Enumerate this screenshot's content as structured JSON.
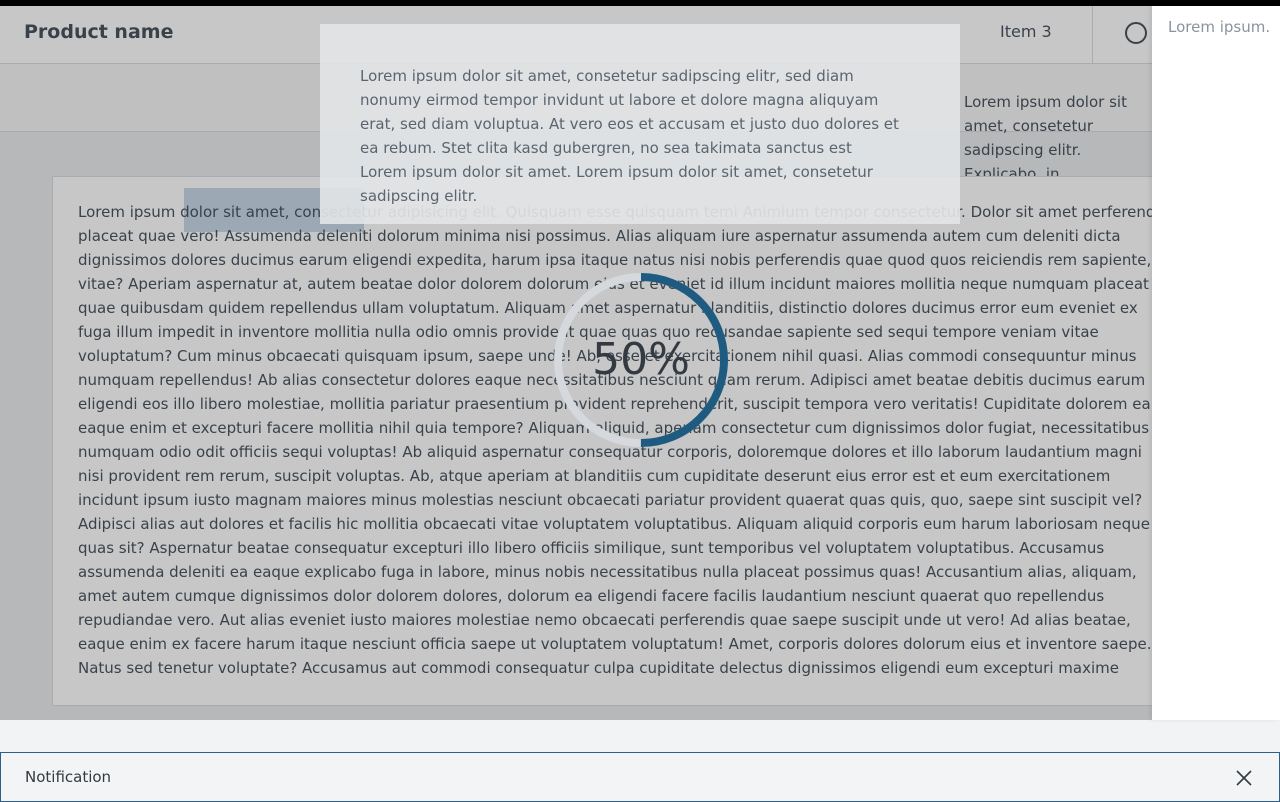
{
  "app": {
    "product_name": "Product name",
    "nav_item": "Item 3",
    "side_text": "Lorem ipsum dolor sit amet, consetetur sadipscing elitr. Explicabo, in",
    "card_text": "Lorem ipsum dolor sit amet, consectetur adipisicing elit. Quisquam esse quisquam temi Animium tempor consectetur. Dolor sit amet perferendis placeat quae vero! Assumenda deleniti dolorum minima nisi possimus. Alias aliquam iure aspernatur assumenda autem cum deleniti dicta dignissimos dolores ducimus earum eligendi expedita, harum ipsa itaque natus nisi nobis perferendis quae quod quos reiciendis rem sapiente, vitae? Aperiam aspernatur at, autem beatae dolor dolorem dolorum eius et eveniet id illum incidunt maiores mollitia neque numquam placeat quae quibusdam quidem repellendus ullam voluptatum. Aliquam amet aspernatur blanditiis, distinctio dolores ducimus error eum eveniet ex fuga illum impedit in inventore mollitia nulla odio omnis provident quae quas quo recusandae sapiente sed sequi tempore veniam vitae voluptatum? Cum minus obcaecati quisquam ipsum, saepe unde! Ab, esse et exercitationem nihil quasi. Alias commodi consequuntur minus numquam repellendus! Ab alias consectetur dolores eaque necessitatibus nesciunt quam rerum. Adipisci amet beatae debitis ducimus earum eligendi eos illo libero molestiae, mollitia pariatur praesentium provident reprehenderit, suscipit tempora vero veritatis! Cupiditate dolorem ea eaque enim et excepturi facere mollitia nihil quia tempore? Aliquam aliquid, aperiam consectetur cum dignissimos dolor fugiat, necessitatibus numquam odio odit officiis sequi voluptas! Ab aliquid aspernatur consequatur corporis, doloremque dolores et illo laborum laudantium magni nisi provident rem rerum, suscipit voluptas. Ab, atque aperiam at blanditiis cum cupiditate deserunt eius error est et eum exercitationem incidunt ipsum iusto magnam maiores minus molestias nesciunt obcaecati pariatur provident quaerat quas quis, quo, saepe sint suscipit vel? Adipisci alias aut dolores et facilis hic mollitia obcaecati vitae voluptatem voluptatibus. Aliquam aliquid corporis eum harum laboriosam neque quas sit? Aspernatur beatae consequatur excepturi illo libero officiis similique, sunt temporibus vel voluptatem voluptatibus. Accusamus assumenda deleniti ea eaque explicabo fuga in labore, minus nobis necessitatibus nulla placeat possimus quas! Accusantium alias, aliquam, amet autem cumque dignissimos dolor dolorem dolores, dolorum ea eligendi facere facilis laudantium nesciunt quaerat quo repellendus repudiandae vero. Aut alias eveniet iusto maiores molestiae nemo obcaecati perferendis quae saepe suscipit unde ut vero! Ad alias beatae, eaque enim ex facere harum itaque nesciunt officia saepe ut voluptatem voluptatum! Amet, corporis dolores dolorum eius et inventore saepe. Natus sed tenetur voluptate? Accusamus aut commodi consequatur culpa cupiditate delectus dignissimos eligendi eum excepturi maxime mollitia natus nesciunt nisi quas, quo, repellat suscipit. A deserunt dicta dolores eius et itaque labore neque quae quas, repellendus rerum."
  },
  "dialog": {
    "text": "Lorem ipsum dolor sit amet, consetetur sadipscing elitr, sed diam nonumy eirmod tempor invidunt ut labore et dolore magna aliquyam erat, sed diam voluptua. At vero eos et accusam et justo duo dolores et ea rebum. Stet clita kasd gubergren, no sea takimata sanctus est Lorem ipsum dolor sit amet. Lorem ipsum dolor sit amet, consetetur sadipscing elitr."
  },
  "progress": {
    "label": "50%",
    "value": 0.5,
    "track_color": "#d5d9dd",
    "fill_color": "#1f5b80"
  },
  "right_panel": {
    "text": "Lorem ipsum."
  },
  "notification": {
    "text": "Notification",
    "close_icon": "close-icon",
    "border_color": "#2b5f8a"
  }
}
